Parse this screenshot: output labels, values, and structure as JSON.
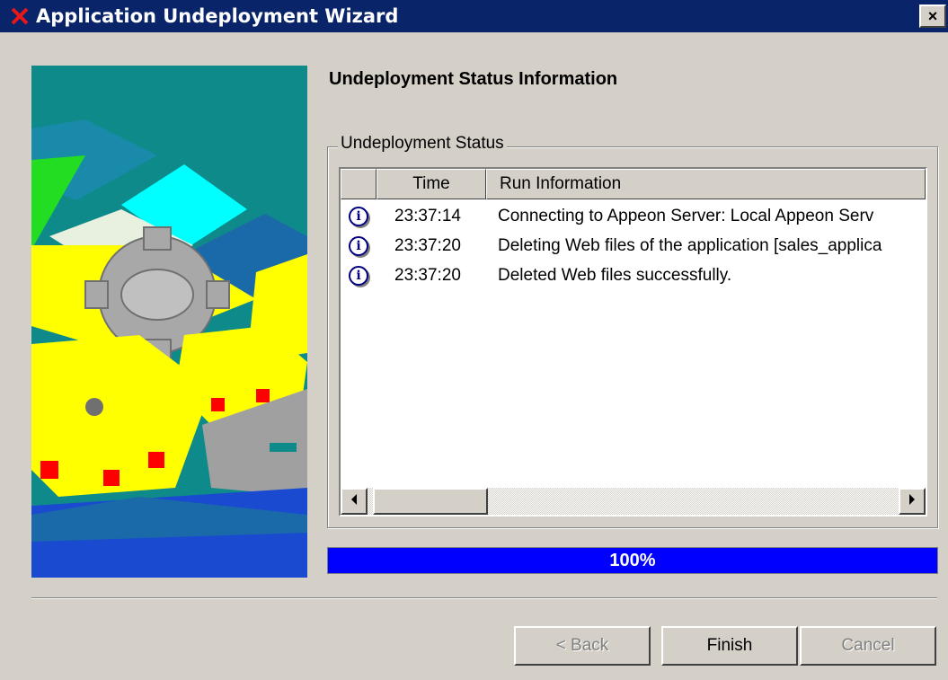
{
  "window": {
    "title": "Application Undeployment Wizard",
    "close_glyph": "×",
    "app_icon": "red-x-icon"
  },
  "page": {
    "heading": "Undeployment Status Information"
  },
  "status_group": {
    "label": "Undeployment Status",
    "columns": [
      "",
      "Time",
      "Run Information"
    ],
    "rows": [
      {
        "icon": "info-icon",
        "time": "23:37:14",
        "info": "Connecting to Appeon Server: Local Appeon Serv"
      },
      {
        "icon": "info-icon",
        "time": "23:37:20",
        "info": "Deleting Web files of the application [sales_applica"
      },
      {
        "icon": "info-icon",
        "time": "23:37:20",
        "info": "Deleted Web files successfully."
      }
    ]
  },
  "progress": {
    "value": 100,
    "label": "100%"
  },
  "buttons": {
    "back": "< Back",
    "finish": "Finish",
    "cancel": "Cancel"
  },
  "colors": {
    "titlebar": "#0a246a",
    "progress_fill": "#0000ff",
    "dialog_bg": "#d4d0c8"
  }
}
